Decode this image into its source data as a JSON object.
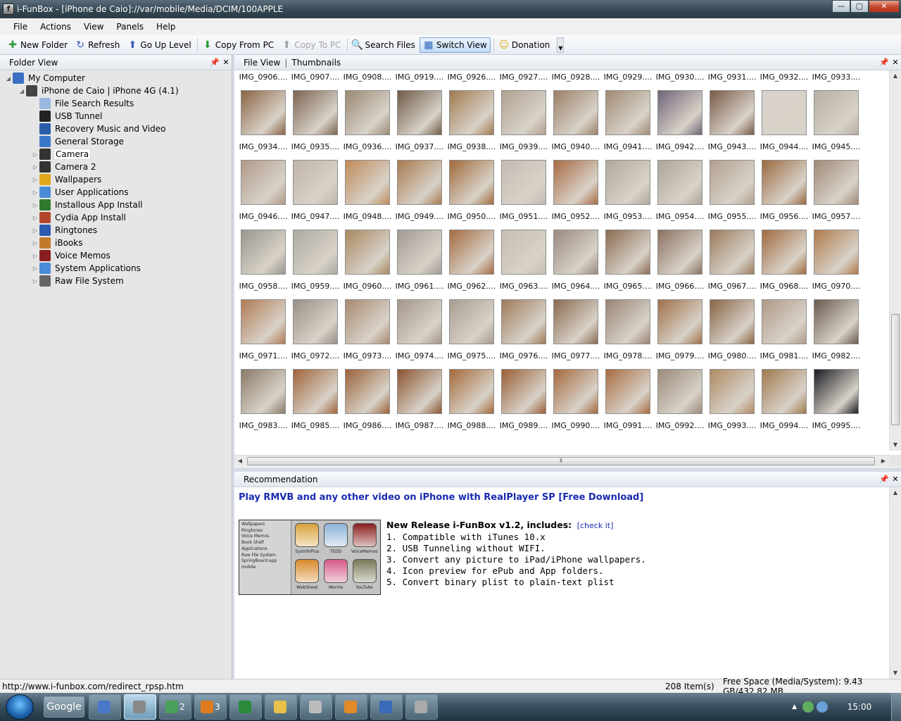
{
  "window": {
    "title": "i-FunBox - [iPhone de Caio]://var/mobile/Media/DCIM/100APPLE",
    "buttons": {
      "minimize": "—",
      "maximize": "▢",
      "close": "✕"
    }
  },
  "menu": [
    "File",
    "Actions",
    "View",
    "Panels",
    "Help"
  ],
  "toolbar": [
    {
      "label": "New Folder",
      "icon": "plus-icon",
      "glyph": "✚",
      "color": "#2f9a35",
      "enabled": true
    },
    {
      "label": "Refresh",
      "icon": "refresh-icon",
      "glyph": "↻",
      "color": "#3a5bb8",
      "enabled": true
    },
    {
      "label": "Go Up Level",
      "icon": "up-arrow-icon",
      "glyph": "⬆",
      "color": "#3a5bb8",
      "enabled": true
    },
    {
      "label": "Copy From PC",
      "icon": "download-arrow-icon",
      "glyph": "⬇",
      "color": "#2f9a35",
      "enabled": true
    },
    {
      "label": "Copy To PC",
      "icon": "upload-arrow-icon",
      "glyph": "⬆",
      "color": "#9aa0a6",
      "enabled": false
    },
    {
      "label": "Search Files",
      "icon": "search-icon",
      "glyph": "🔍",
      "color": "#1f3f8a",
      "enabled": true
    },
    {
      "label": "Switch View",
      "icon": "grid-view-icon",
      "glyph": "▦",
      "color": "#2c64b5",
      "enabled": true,
      "active": true
    },
    {
      "label": "Donation",
      "icon": "smiley-icon",
      "glyph": "☺",
      "color": "#e0b21c",
      "enabled": true
    }
  ],
  "folder_panel": {
    "title": "Folder View",
    "pin": "📌",
    "close": "✕",
    "tree": [
      {
        "label": "My Computer",
        "depth": 0,
        "expander": "◢",
        "icon": "computer-icon",
        "color": "#3a6fc4"
      },
      {
        "label": "iPhone de Caio | iPhone 4G (4.1)",
        "depth": 1,
        "expander": "◢",
        "icon": "iphone-icon",
        "color": "#444"
      },
      {
        "label": "File Search Results",
        "depth": 2,
        "expander": "",
        "icon": "search-results-icon",
        "color": "#9ab8e0"
      },
      {
        "label": "USB Tunnel",
        "depth": 2,
        "expander": "",
        "icon": "usb-tunnel-icon",
        "color": "#222"
      },
      {
        "label": "Recovery Music and Video",
        "depth": 2,
        "expander": "",
        "icon": "media-icon",
        "color": "#2b5da8"
      },
      {
        "label": "General Storage",
        "depth": 2,
        "expander": "",
        "icon": "storage-icon",
        "color": "#3a79c9"
      },
      {
        "label": "Camera",
        "depth": 2,
        "expander": "▷",
        "icon": "camera-icon",
        "color": "#333",
        "selected": true
      },
      {
        "label": "Camera 2",
        "depth": 2,
        "expander": "▷",
        "icon": "camera-icon",
        "color": "#333"
      },
      {
        "label": "Wallpapers",
        "depth": 2,
        "expander": "▷",
        "icon": "sunflower-icon",
        "color": "#e2a61c"
      },
      {
        "label": "User Applications",
        "depth": 2,
        "expander": "▷",
        "icon": "apps-icon",
        "color": "#4a8bd8"
      },
      {
        "label": "Installous App Install",
        "depth": 2,
        "expander": "▷",
        "icon": "installous-icon",
        "color": "#2f7a2f"
      },
      {
        "label": "Cydia App Install",
        "depth": 2,
        "expander": "▷",
        "icon": "cydia-icon",
        "color": "#b3452c"
      },
      {
        "label": "Ringtones",
        "depth": 2,
        "expander": "▷",
        "icon": "ringtone-icon",
        "color": "#2c5bb0"
      },
      {
        "label": "iBooks",
        "depth": 2,
        "expander": "▷",
        "icon": "ibooks-icon",
        "color": "#c27a2a"
      },
      {
        "label": "Voice Memos",
        "depth": 2,
        "expander": "▷",
        "icon": "voice-memo-icon",
        "color": "#8b1f1f"
      },
      {
        "label": "System Applications",
        "depth": 2,
        "expander": "▷",
        "icon": "system-apps-icon",
        "color": "#4a8bd8"
      },
      {
        "label": "Raw File System",
        "depth": 2,
        "expander": "▷",
        "icon": "raw-fs-icon",
        "color": "#666"
      }
    ]
  },
  "file_panel": {
    "title": "File View",
    "separator": "|",
    "view": "Thumbnails",
    "pin": "📌",
    "close": "✕",
    "scroll_position": 0.6,
    "thumbnails": [
      {
        "name": "IMG_0906....",
        "color": "#7a3a1c"
      },
      {
        "name": "IMG_0907....",
        "color": "#5c3a25"
      },
      {
        "name": "IMG_0908....",
        "color": "#6a2e1a"
      },
      {
        "name": "IMG_0919....",
        "color": "#5a4030"
      },
      {
        "name": "IMG_0926....",
        "color": "#8a5a3a"
      },
      {
        "name": "IMG_0927....",
        "color": "#8c6a4a"
      },
      {
        "name": "IMG_0928....",
        "color": "#9a6240"
      },
      {
        "name": "IMG_0929....",
        "color": "#8a5230"
      },
      {
        "name": "IMG_0930....",
        "color": "#7c4a2a"
      },
      {
        "name": "IMG_0931....",
        "color": "#8a5a34"
      },
      {
        "name": "IMG_0932....",
        "color": "#9a6a44"
      },
      {
        "name": "IMG_0933....",
        "color": "#a8a09a"
      },
      {
        "name": "IMG_0934....",
        "color": "#8a6444"
      },
      {
        "name": "IMG_0935....",
        "color": "#7c6452"
      },
      {
        "name": "IMG_0936....",
        "color": "#9a8874"
      },
      {
        "name": "IMG_0937....",
        "color": "#6e5a48"
      },
      {
        "name": "IMG_0938....",
        "color": "#a07a50"
      },
      {
        "name": "IMG_0939....",
        "color": "#b0a090"
      },
      {
        "name": "IMG_0940....",
        "color": "#9a8068"
      },
      {
        "name": "IMG_0941....",
        "color": "#a08a74"
      },
      {
        "name": "IMG_0942....",
        "color": "#6e6478"
      },
      {
        "name": "IMG_0943....",
        "color": "#7a5a48"
      },
      {
        "name": "IMG_0944....",
        "color": "#d8d2cc"
      },
      {
        "name": "IMG_0945....",
        "color": "#b8aea4"
      },
      {
        "name": "IMG_0946....",
        "color": "#b09a8a"
      },
      {
        "name": "IMG_0947....",
        "color": "#c0b4a8"
      },
      {
        "name": "IMG_0948....",
        "color": "#c08a5a"
      },
      {
        "name": "IMG_0949....",
        "color": "#a87a50"
      },
      {
        "name": "IMG_0950....",
        "color": "#a06a3a"
      },
      {
        "name": "IMG_0951....",
        "color": "#c4bcb4"
      },
      {
        "name": "IMG_0952....",
        "color": "#a86a44"
      },
      {
        "name": "IMG_0953....",
        "color": "#b0a89c"
      },
      {
        "name": "IMG_0954....",
        "color": "#aca498"
      },
      {
        "name": "IMG_0955....",
        "color": "#b2a090"
      },
      {
        "name": "IMG_0956....",
        "color": "#9a6a40"
      },
      {
        "name": "IMG_0957....",
        "color": "#a08a78"
      },
      {
        "name": "IMG_0958....",
        "color": "#9a968e"
      },
      {
        "name": "IMG_0959....",
        "color": "#aeaaa2"
      },
      {
        "name": "IMG_0960....",
        "color": "#a88860"
      },
      {
        "name": "IMG_0961....",
        "color": "#a09a94"
      },
      {
        "name": "IMG_0962....",
        "color": "#a46a40"
      },
      {
        "name": "IMG_0963....",
        "color": "#c6bdb2"
      },
      {
        "name": "IMG_0964....",
        "color": "#9a8a80"
      },
      {
        "name": "IMG_0965....",
        "color": "#8a6a50"
      },
      {
        "name": "IMG_0966....",
        "color": "#8a7060"
      },
      {
        "name": "IMG_0967....",
        "color": "#9a7a5c"
      },
      {
        "name": "IMG_0968....",
        "color": "#a06a3e"
      },
      {
        "name": "IMG_0970....",
        "color": "#b07a4a"
      },
      {
        "name": "IMG_0971....",
        "color": "#b07a54"
      },
      {
        "name": "IMG_0972....",
        "color": "#9a9088"
      },
      {
        "name": "IMG_0973....",
        "color": "#a88a70"
      },
      {
        "name": "IMG_0974....",
        "color": "#a4968a"
      },
      {
        "name": "IMG_0975....",
        "color": "#a89c90"
      },
      {
        "name": "IMG_0976....",
        "color": "#a07a5a"
      },
      {
        "name": "IMG_0977....",
        "color": "#8a6a50"
      },
      {
        "name": "IMG_0978....",
        "color": "#9a8476"
      },
      {
        "name": "IMG_0979....",
        "color": "#a0704a"
      },
      {
        "name": "IMG_0980....",
        "color": "#8a6444"
      },
      {
        "name": "IMG_0981....",
        "color": "#b09a88"
      },
      {
        "name": "IMG_0982....",
        "color": "#6a5a4e"
      },
      {
        "name": "IMG_0983....",
        "color": "#8a7a68"
      },
      {
        "name": "IMG_0985....",
        "color": "#a0643a"
      },
      {
        "name": "IMG_0986....",
        "color": "#9a6238"
      },
      {
        "name": "IMG_0987....",
        "color": "#8a5430"
      },
      {
        "name": "IMG_0988....",
        "color": "#a46a3c"
      },
      {
        "name": "IMG_0989....",
        "color": "#9a5e36"
      },
      {
        "name": "IMG_0990....",
        "color": "#a4683e"
      },
      {
        "name": "IMG_0991....",
        "color": "#a86c40"
      },
      {
        "name": "IMG_0992....",
        "color": "#9a8a7a"
      },
      {
        "name": "IMG_0993....",
        "color": "#b08a64"
      },
      {
        "name": "IMG_0994....",
        "color": "#a07a4e"
      },
      {
        "name": "IMG_0995....",
        "color": "#1c1c24"
      }
    ]
  },
  "recommendation": {
    "title": "Recommendation",
    "pin": "📌",
    "close": "✕",
    "link": "Play RMVB and any other video on iPhone with RealPlayer SP [Free Download]",
    "headline": "New Release i-FunBox v1.2, includes:",
    "check": "[check it]",
    "features": [
      "1. Compatible with iTunes 10.x",
      "2. USB Tunneling without WIFI.",
      "3. Convert any picture to iPad/iPhone wallpapers.",
      "4. Icon preview for ePub and App folders.",
      "5. Convert binary plist to plain-text plist"
    ],
    "preview_tree": [
      "Wallpapers",
      "Ringtones",
      "Voice Memos",
      "Book Shelf",
      "Applications",
      "Raw File System",
      "SpringBoard.app",
      "mobile"
    ],
    "preview_apps": [
      {
        "label": "SysInfoPlus",
        "color": "#d9a23a"
      },
      {
        "label": "TEDD",
        "color": "#8fb3d9"
      },
      {
        "label": "VoiceMemos",
        "color": "#8b1f1f"
      },
      {
        "label": "WebSheet",
        "color": "#d98a2a"
      },
      {
        "label": "Worms",
        "color": "#d45a8a"
      },
      {
        "label": "YouTube",
        "color": "#7a7a5a"
      }
    ]
  },
  "status": {
    "url": "http://www.i-funbox.com/redirect_rpsp.htm",
    "items": "208 Item(s)",
    "free_space": "Free Space (Media/System): 9.43 GB/432.82 MB"
  },
  "taskbar": {
    "google": "Google",
    "buttons": [
      {
        "name": "itunes",
        "icon": "itunes-icon",
        "color": "#4a78c8",
        "count": ""
      },
      {
        "name": "ifunbox",
        "icon": "ifunbox-icon",
        "color": "#888",
        "count": "",
        "active": true
      },
      {
        "name": "msn",
        "icon": "msn-icon",
        "color": "#4aa05a",
        "count": "2"
      },
      {
        "name": "firefox",
        "icon": "firefox-icon",
        "color": "#e07a1f",
        "count": "3"
      },
      {
        "name": "flag",
        "icon": "flag-icon",
        "color": "#2a8a3a",
        "count": ""
      },
      {
        "name": "explorer",
        "icon": "folder-icon",
        "color": "#e8c04a",
        "count": ""
      },
      {
        "name": "printer",
        "icon": "printer-icon",
        "color": "#bbb",
        "count": ""
      },
      {
        "name": "media",
        "icon": "media-player-icon",
        "color": "#e08a2a",
        "count": ""
      },
      {
        "name": "network",
        "icon": "network-icon",
        "color": "#3a6ab8",
        "count": ""
      },
      {
        "name": "paint",
        "icon": "paint-icon",
        "color": "#aaa",
        "count": ""
      }
    ],
    "clock": "15:00"
  }
}
